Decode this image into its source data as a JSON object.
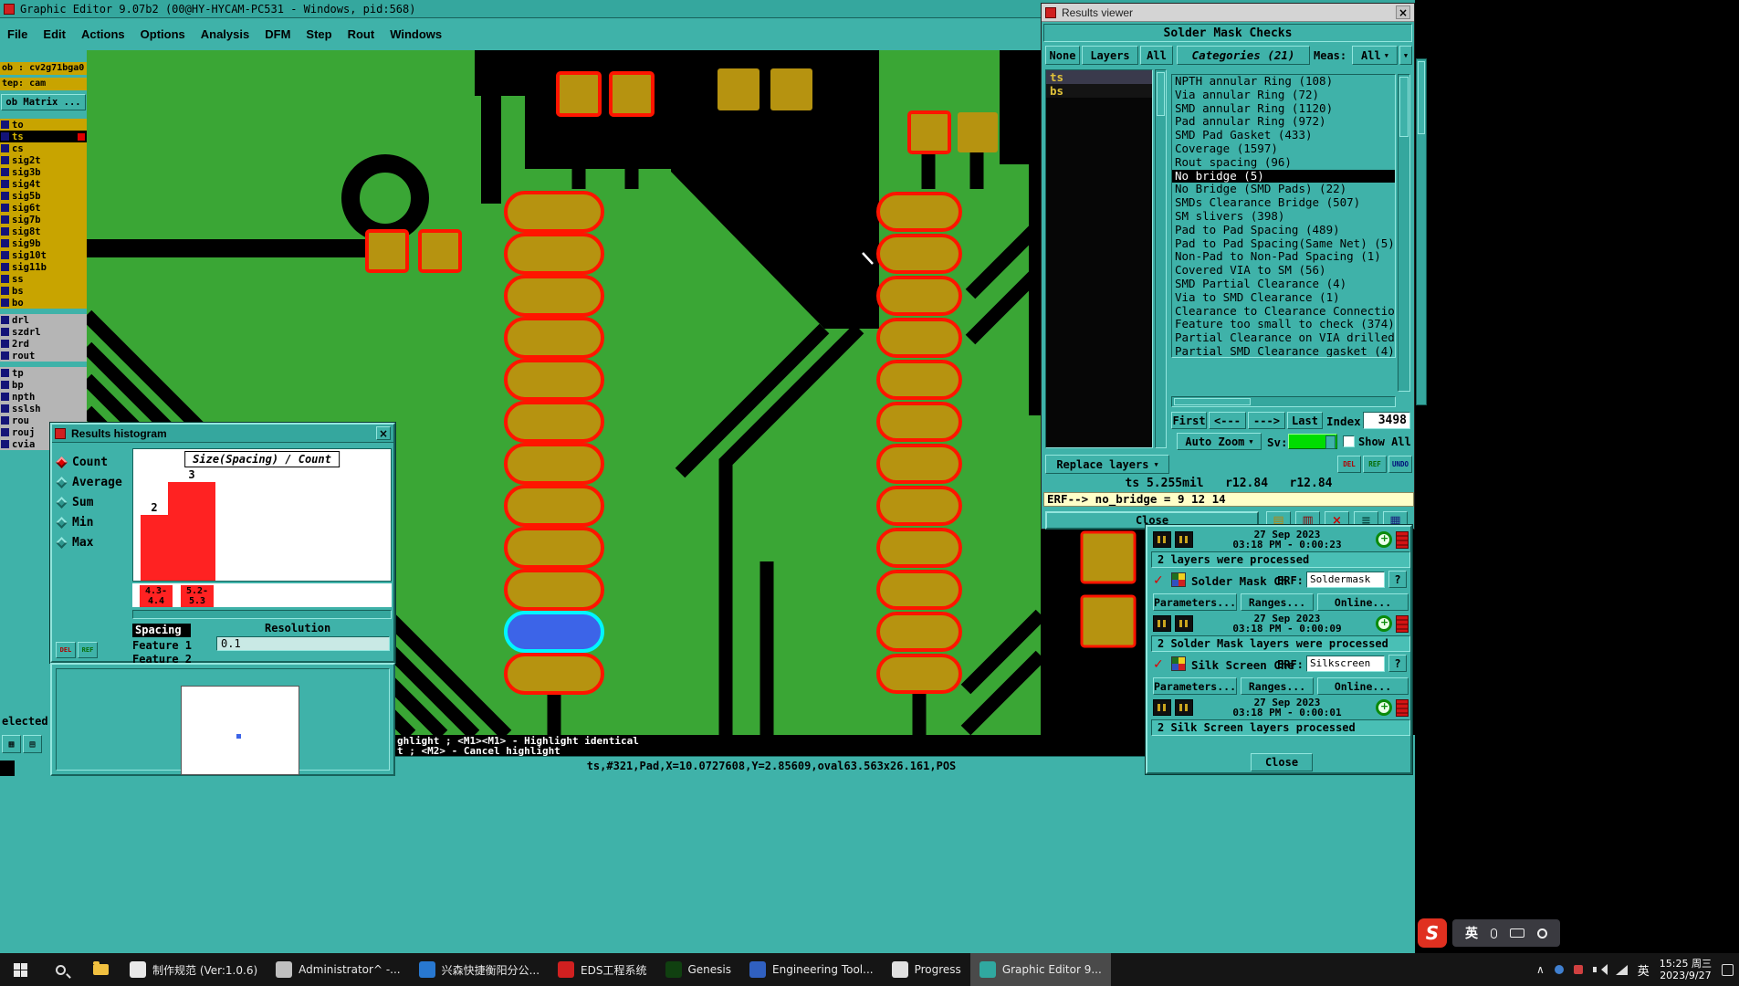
{
  "colors": {
    "teal": "#3fb2a9",
    "pcb_green": "#3aa635",
    "pad_gold": "#b69310",
    "pad_outline": "#ff1500",
    "highlight_blue": "#3c64e8",
    "highlight_cyan": "#00f5ff",
    "layer_gold": "#c8a400",
    "layer_gray": "#b5b5b5",
    "warn_yellow": "#ffffc8",
    "bar_red": "#ff2222",
    "sv_green": "#00dd00"
  },
  "glyphs": {
    "close": "×",
    "dropdown": "▼",
    "check": "✓",
    "chevron_up": "∧",
    "grid": "▦",
    "grid2": "▤"
  },
  "window": {
    "title": "Graphic Editor 9.07b2 (00@HY-HYCAM-PC531 - Windows, pid:568)",
    "menu": [
      "File",
      "Edit",
      "Actions",
      "Options",
      "Analysis",
      "DFM",
      "Step",
      "Rout",
      "Windows"
    ]
  },
  "sidebar": {
    "job": "ob : cv2g71bga0",
    "step": "tep: cam",
    "matrix": "ob Matrix ...",
    "selected_text": "elected",
    "layers": [
      {
        "name": "to",
        "cls": "gold"
      },
      {
        "name": "ts",
        "cls": "gold selected"
      },
      {
        "name": "cs",
        "cls": "gold"
      },
      {
        "name": "sig2t",
        "cls": "gold"
      },
      {
        "name": "sig3b",
        "cls": "gold"
      },
      {
        "name": "sig4t",
        "cls": "gold"
      },
      {
        "name": "sig5b",
        "cls": "gold"
      },
      {
        "name": "sig6t",
        "cls": "gold"
      },
      {
        "name": "sig7b",
        "cls": "gold"
      },
      {
        "name": "sig8t",
        "cls": "gold"
      },
      {
        "name": "sig9b",
        "cls": "gold"
      },
      {
        "name": "sig10t",
        "cls": "gold"
      },
      {
        "name": "sig11b",
        "cls": "gold"
      },
      {
        "name": "ss",
        "cls": "gold"
      },
      {
        "name": "bs",
        "cls": "gold"
      },
      {
        "name": "bo",
        "cls": "gold"
      },
      {
        "name": "drl",
        "cls": "gray gap"
      },
      {
        "name": "szdrl",
        "cls": "gray"
      },
      {
        "name": "2rd",
        "cls": "gray"
      },
      {
        "name": "rout",
        "cls": "gray"
      },
      {
        "name": "tp",
        "cls": "gray gap"
      },
      {
        "name": "bp",
        "cls": "gray"
      },
      {
        "name": "npth",
        "cls": "gray"
      },
      {
        "name": "sslsh",
        "cls": "gray"
      },
      {
        "name": "rou",
        "cls": "gray"
      },
      {
        "name": "rouj",
        "cls": "gray"
      },
      {
        "name": "cvia",
        "cls": "gray"
      }
    ]
  },
  "status_bar": {
    "line1": "ghlight ; <M1><M1> - Highlight identical",
    "line2": "t ; <M2> - Cancel highlight",
    "coords": "ts,#321,Pad,X=10.0727608,Y=2.85609,oval63.563x26.161,POS"
  },
  "histogram": {
    "title": "Results histogram",
    "stats": [
      {
        "label": "Count",
        "cls": "sel"
      },
      {
        "label": "Average"
      },
      {
        "label": "Sum"
      },
      {
        "label": "Min"
      },
      {
        "label": "Max"
      }
    ],
    "chart_data": {
      "type": "bar",
      "title": "Size(Spacing) / Count",
      "categories": [
        "4.3-4.4",
        "5.2-5.3"
      ],
      "values": [
        2,
        3
      ],
      "ylim": [
        0,
        3
      ],
      "bar_color": "#ff2222",
      "tick_lines": [
        [
          "4.3-",
          "4.4"
        ],
        [
          "5.2-",
          "5.3"
        ]
      ],
      "xlabel": "Size(Spacing)",
      "ylabel": "Count"
    },
    "fields": [
      "Spacing",
      "Feature 1",
      "Feature 2"
    ],
    "resolution_label": "Resolution",
    "resolution_value": "0.1",
    "del": "DEL",
    "ref": "REF"
  },
  "results_viewer": {
    "title": "Results viewer",
    "header": "Solder Mask Checks",
    "filter_buttons": [
      "None",
      "Layers",
      "All"
    ],
    "categories_label": "Categories (21)",
    "meas_label": "Meas:",
    "meas_value": "All",
    "layer_items": [
      "ts",
      "bs"
    ],
    "categories": [
      {
        "label": "NPTH annular Ring (108)"
      },
      {
        "label": "Via annular Ring (72)"
      },
      {
        "label": "SMD annular Ring (1120)"
      },
      {
        "label": "Pad annular Ring (972)"
      },
      {
        "label": "SMD Pad Gasket (433)"
      },
      {
        "label": "Coverage (1597)"
      },
      {
        "label": "Rout spacing (96)"
      },
      {
        "label": "No bridge (5)",
        "cls": "sel"
      },
      {
        "label": "No Bridge (SMD Pads) (22)"
      },
      {
        "label": "SMDs Clearance Bridge (507)"
      },
      {
        "label": "SM slivers (398)"
      },
      {
        "label": "Pad to Pad Spacing (489)"
      },
      {
        "label": "Pad to Pad Spacing(Same Net) (5)"
      },
      {
        "label": "Non-Pad to Non-Pad Spacing (1)"
      },
      {
        "label": "Covered VIA to SM (56)"
      },
      {
        "label": "SMD Partial Clearance (4)"
      },
      {
        "label": "Via to SMD Clearance (1)"
      },
      {
        "label": "Clearance to Clearance Connectio"
      },
      {
        "label": "Feature too small to check (374)"
      },
      {
        "label": "Partial Clearance on VIA drilled"
      },
      {
        "label": "Partial SMD Clearance gasket (4)"
      }
    ],
    "nav": {
      "first": "First",
      "prev": "<---",
      "next": "--->",
      "last": "Last",
      "index_label": "Index:",
      "index_value": "3498"
    },
    "auto_zoom": "Auto Zoom",
    "sv_label": "Sv:",
    "show_all": "Show All",
    "replace_layers": "Replace layers",
    "mini_buttons": [
      {
        "label": "DEL",
        "c": "#b00000"
      },
      {
        "label": "REF",
        "c": "#076d07"
      },
      {
        "label": "UNDO",
        "c": "#00107a"
      }
    ],
    "measure_line": "ts 5.255mil   r12.84   r12.84",
    "erf_line": "ERF--> no_bridge = 9 12 14",
    "close": "Close",
    "action_icons": [
      {
        "g": "▤",
        "c": "#b8860b"
      },
      {
        "g": "▥",
        "c": "#8b0000"
      },
      {
        "g": "×",
        "c": "#cc0000"
      },
      {
        "g": "≡",
        "c": "#0a4a44"
      },
      {
        "g": "▦",
        "c": "#1a237e"
      }
    ]
  },
  "checklist": {
    "runs": [
      {
        "date": "27 Sep 2023",
        "time": "03:18 PM - 0:00:23",
        "status": "2 layers were processed"
      },
      {
        "date": "27 Sep 2023",
        "time": "03:18 PM - 0:00:09",
        "status": "2 Solder Mask layers were processed"
      },
      {
        "date": "27 Sep 2023",
        "time": "03:18 PM - 0:00:01",
        "status": "2 Silk Screen layers processed"
      }
    ],
    "checks": [
      {
        "label": "Solder Mask Ch",
        "erf": "Soldermask"
      },
      {
        "label": "Silk Screen Che",
        "erf": "Silkscreen"
      }
    ],
    "erf_label": "ERF:",
    "action_buttons": [
      "Parameters...",
      "Ranges...",
      "Online..."
    ],
    "help": "?",
    "close": "Close"
  },
  "taskbar": {
    "items": [
      {
        "label": "制作规范 (Ver:1.0.6)",
        "ic": "#e8e8e8"
      },
      {
        "label": "Administrator^ -...",
        "ic": "#c0c0c0"
      },
      {
        "label": "兴森快捷衡阳分公...",
        "ic": "#2878d0"
      },
      {
        "label": "EDS工程系统",
        "ic": "#d02020"
      },
      {
        "label": "Genesis",
        "ic": "#104010"
      },
      {
        "label": "Engineering Tool...",
        "ic": "#3060c0"
      },
      {
        "label": "Progress",
        "ic": "#e0e0e0"
      },
      {
        "label": "Graphic Editor 9...",
        "ic": "#30a8a0",
        "cls": "active"
      }
    ],
    "tray_lang": "英",
    "clock_time": "15:25 周三",
    "clock_date": "2023/9/27"
  },
  "ime": {
    "logo": "S",
    "lang": "英"
  }
}
